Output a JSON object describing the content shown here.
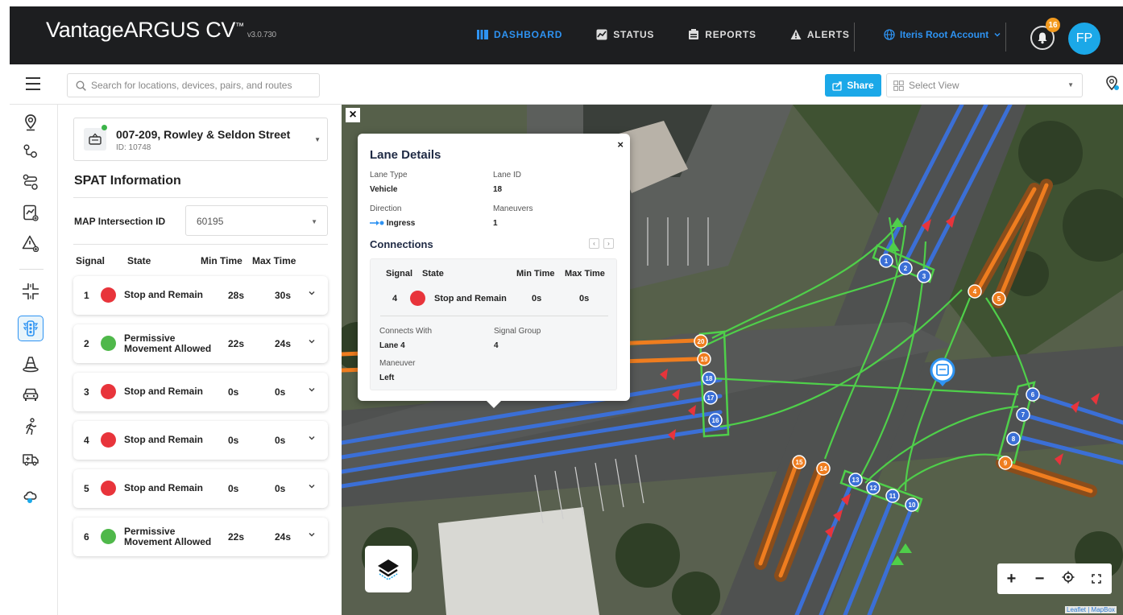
{
  "app": {
    "brand_part1": "Vantage",
    "brand_part2": "ARGUS CV",
    "trademark": "™",
    "version": "v3.0.730"
  },
  "nav": [
    {
      "label": "DASHBOARD",
      "icon": "dashboard-icon",
      "active": true
    },
    {
      "label": "STATUS",
      "icon": "status-icon",
      "active": false
    },
    {
      "label": "REPORTS",
      "icon": "reports-icon",
      "active": false
    },
    {
      "label": "ALERTS",
      "icon": "alert-icon",
      "active": false
    }
  ],
  "account": {
    "label": "Iteris Root Account"
  },
  "notifications": {
    "count": "16"
  },
  "user": {
    "initials": "FP"
  },
  "toolbar": {
    "search_placeholder": "Search for locations, devices, pairs, and routes",
    "share_label": "Share",
    "select_view_label": "Select View"
  },
  "location": {
    "name": "007-209, Rowley & Seldon Street",
    "id_text": "ID: 10748"
  },
  "spat": {
    "title": "SPAT Information",
    "map_id_label": "MAP Intersection ID",
    "map_id_value": "60195",
    "headers": {
      "signal": "Signal",
      "state": "State",
      "min": "Min Time",
      "max": "Max Time"
    },
    "rows": [
      {
        "signal": "1",
        "state": "Stop and Remain",
        "min": "28s",
        "max": "30s",
        "color": "#e8343b"
      },
      {
        "signal": "2",
        "state": "Permissive Movement Allowed",
        "min": "22s",
        "max": "24s",
        "color": "#4fb84a"
      },
      {
        "signal": "3",
        "state": "Stop and Remain",
        "min": "0s",
        "max": "0s",
        "color": "#e8343b"
      },
      {
        "signal": "4",
        "state": "Stop and Remain",
        "min": "0s",
        "max": "0s",
        "color": "#e8343b"
      },
      {
        "signal": "5",
        "state": "Stop and Remain",
        "min": "0s",
        "max": "0s",
        "color": "#e8343b"
      },
      {
        "signal": "6",
        "state": "Permissive Movement Allowed",
        "min": "22s",
        "max": "24s",
        "color": "#4fb84a"
      }
    ]
  },
  "lane_details": {
    "title": "Lane Details",
    "lane_type_label": "Lane Type",
    "lane_type_value": "Vehicle",
    "lane_id_label": "Lane ID",
    "lane_id_value": "18",
    "direction_label": "Direction",
    "direction_value": "Ingress",
    "maneuvers_label": "Maneuvers",
    "maneuvers_value": "1",
    "connections_title": "Connections",
    "conn_headers": {
      "signal": "Signal",
      "state": "State",
      "min": "Min Time",
      "max": "Max Time"
    },
    "connection": {
      "signal": "4",
      "state": "Stop and Remain",
      "min": "0s",
      "max": "0s",
      "color": "#e8343b",
      "connects_with_label": "Connects With",
      "connects_with_value": "Lane 4",
      "signal_group_label": "Signal Group",
      "signal_group_value": "4",
      "maneuver_label": "Maneuver",
      "maneuver_value": "Left"
    }
  },
  "map": {
    "attribution": "Leaflet | MapBox",
    "lane_markers": {
      "blue": [
        "1",
        "2",
        "3",
        "6",
        "7",
        "8",
        "10",
        "11",
        "12",
        "13",
        "16",
        "17",
        "18"
      ],
      "orange": [
        "4",
        "5",
        "9",
        "14",
        "15",
        "19",
        "20"
      ]
    }
  },
  "colors": {
    "accent": "#1ba8e8",
    "nav_active": "#2e93f2",
    "stop": "#e8343b",
    "go": "#4fb84a",
    "badge": "#f39a1e"
  }
}
